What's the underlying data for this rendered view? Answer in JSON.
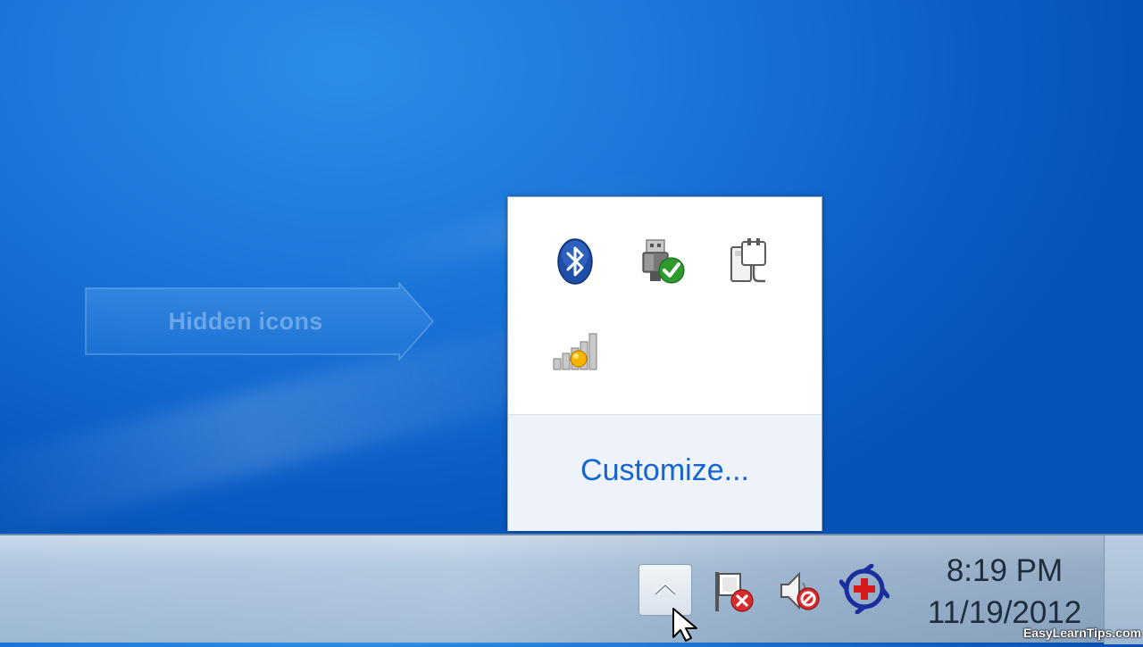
{
  "desktop": {
    "callout_label": "Hidden icons"
  },
  "flyout": {
    "icons": [
      {
        "name": "bluetooth-icon"
      },
      {
        "name": "safely-remove-hardware-icon"
      },
      {
        "name": "power-plug-icon"
      },
      {
        "name": "wireless-signal-icon"
      }
    ],
    "customize_label": "Customize..."
  },
  "taskbar": {
    "show_hidden_icon": "chevron-up-icon",
    "tray_icons": [
      {
        "name": "action-center-flag-icon",
        "status": "error"
      },
      {
        "name": "volume-muted-icon",
        "status": "disabled"
      },
      {
        "name": "network-globe-icon"
      }
    ],
    "clock": {
      "time": "8:19 PM",
      "date": "11/19/2012"
    }
  },
  "watermark": "EasyLearnTips.com",
  "colors": {
    "desktop_blue": "#1a74d8",
    "link_blue": "#1565d0",
    "taskbar": "#aec6de"
  }
}
